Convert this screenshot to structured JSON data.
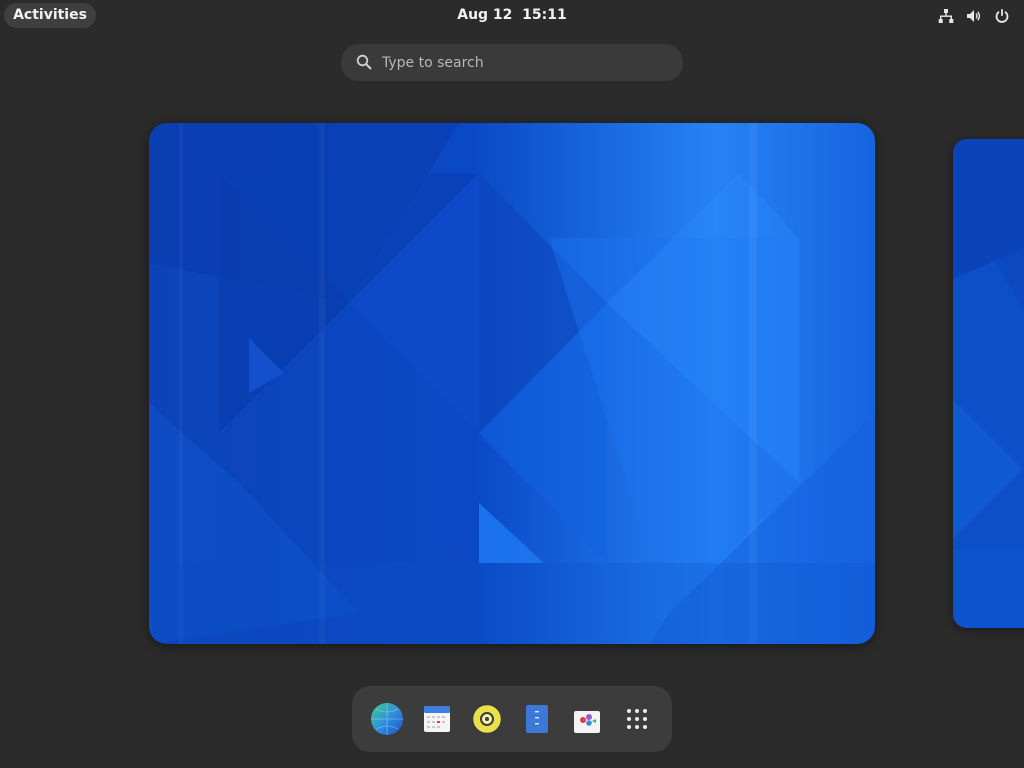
{
  "topbar": {
    "activities_label": "Activities",
    "date": "Aug 12",
    "time": "15:11",
    "tray": [
      "network-icon",
      "volume-icon",
      "power-icon"
    ]
  },
  "search": {
    "placeholder": "Type to search"
  },
  "workspaces": [
    {
      "name": "workspace-1",
      "state": "active"
    },
    {
      "name": "workspace-2",
      "state": "partial-preview"
    }
  ],
  "dash": {
    "items": [
      {
        "name": "web-browser-icon"
      },
      {
        "name": "calendar-icon"
      },
      {
        "name": "rhythmbox-icon"
      },
      {
        "name": "text-editor-icon"
      },
      {
        "name": "software-store-icon"
      },
      {
        "name": "show-apps-grid-icon"
      }
    ]
  },
  "colors": {
    "panel_bg": "#2b2b2b",
    "accent_blue": "#1a5fd6",
    "wallpaper_dark": "#0b3eb0",
    "wallpaper_light": "#2a8cff"
  }
}
